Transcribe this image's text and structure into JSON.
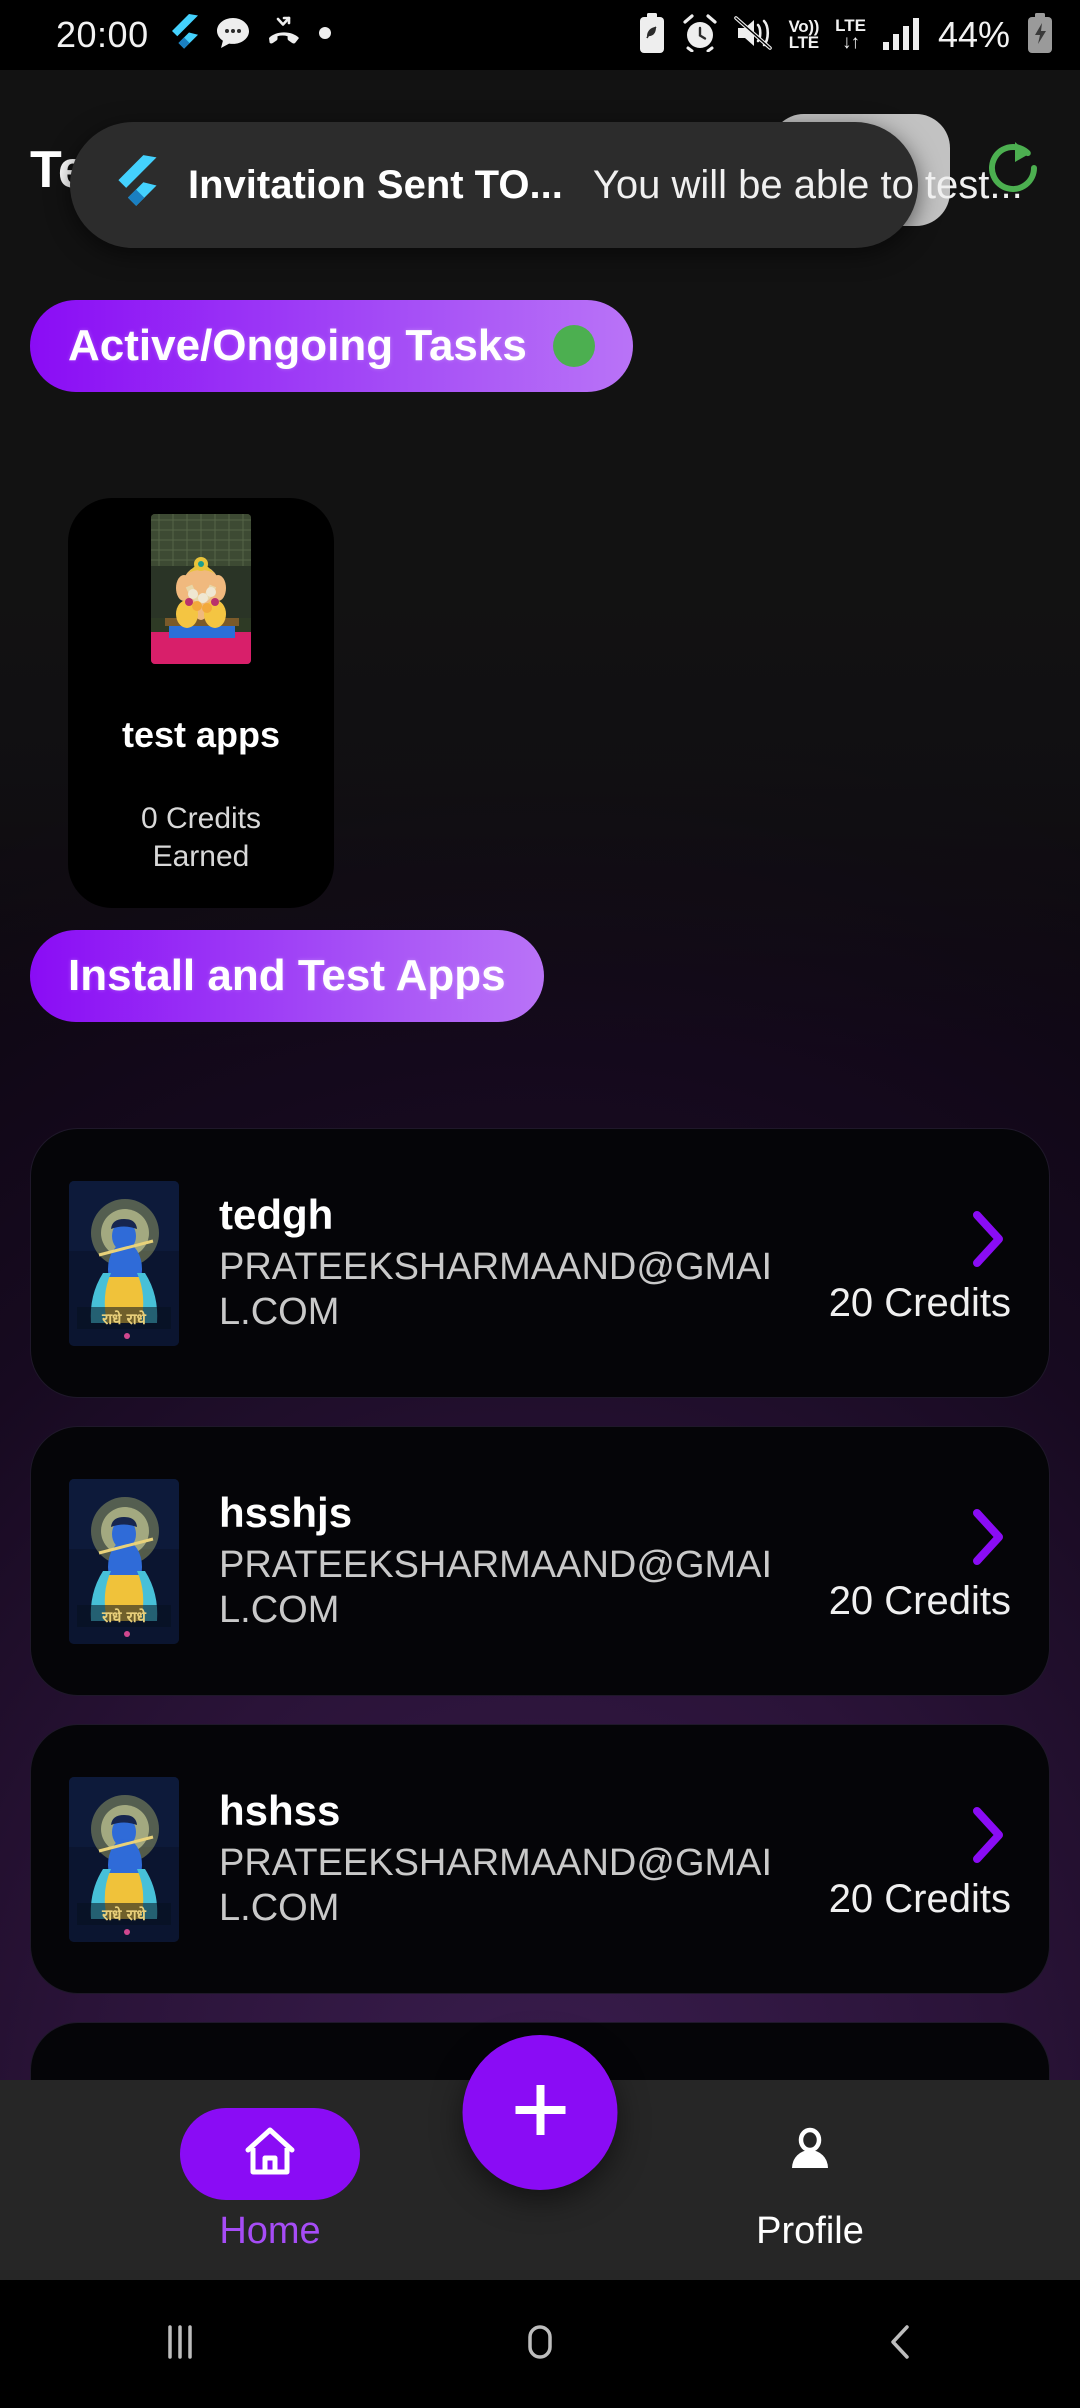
{
  "status_bar": {
    "time": "20:00",
    "battery_percent": "44%",
    "network_voice": "Vo))",
    "network_voice_sub": "LTE",
    "network_type": "LTE",
    "left_icons": [
      "flutter-icon",
      "message-bubble-icon",
      "missed-call-icon",
      "dot-icon"
    ],
    "right_icons": [
      "battery-saver-icon",
      "alarm-icon",
      "mute-icon",
      "volte-icon",
      "lte-data-icon",
      "signal-bars-icon",
      "battery-charging-icon"
    ]
  },
  "app_bar": {
    "title": "Test",
    "refresh_icon": "refresh-icon",
    "refresh_color": "#4caf50",
    "credit_badge_label": ""
  },
  "toast": {
    "icon": "flutter-icon",
    "title": "Invitation Sent TO...",
    "body": "You will be able to test..."
  },
  "sections": {
    "active": {
      "label": "Active/Ongoing Tasks",
      "status_dot_color": "#4caf50"
    },
    "install": {
      "label": "Install and Test Apps"
    }
  },
  "active_task": {
    "thumbnail": "ganesha-idol-thumbnail",
    "name": "test apps",
    "credits_line1": "0 Credits",
    "credits_line2": "Earned"
  },
  "apps": [
    {
      "thumbnail": "krishna-thumbnail",
      "name": "tedgh",
      "email": "PRATEEKSHARMAAND@GMAIL.COM",
      "credits": "20 Credits",
      "chevron": "chevron-right-icon"
    },
    {
      "thumbnail": "krishna-thumbnail",
      "name": "hsshjs",
      "email": "PRATEEKSHARMAAND@GMAIL.COM",
      "credits": "20 Credits",
      "chevron": "chevron-right-icon"
    },
    {
      "thumbnail": "krishna-thumbnail",
      "name": "hshss",
      "email": "PRATEEKSHARMAAND@GMAIL.COM",
      "credits": "20 Credits",
      "chevron": "chevron-right-icon"
    }
  ],
  "fab": {
    "icon": "plus-icon",
    "color": "#8a0cf5"
  },
  "bottom_nav": {
    "items": [
      {
        "label": "Home",
        "icon": "home-icon",
        "active": true
      },
      {
        "label": "Profile",
        "icon": "person-icon",
        "active": false
      }
    ],
    "active_color": "#a64cf6"
  },
  "system_nav": {
    "recents": "recents-icon",
    "home": "home-circle-icon",
    "back": "back-icon"
  }
}
